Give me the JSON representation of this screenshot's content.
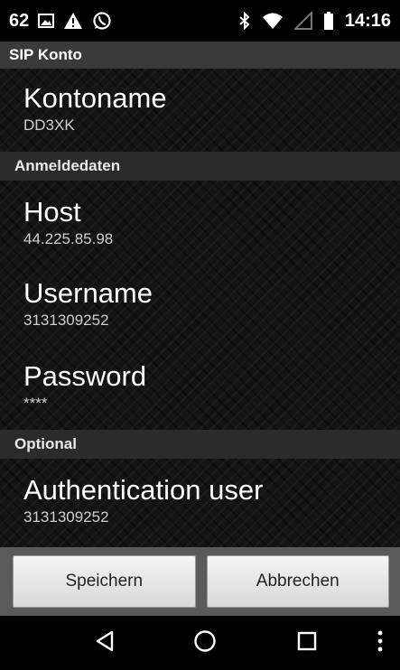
{
  "statusbar": {
    "notification_count": "62",
    "time": "14:16",
    "left_icons": [
      "image-icon",
      "warning-icon",
      "whatsapp-icon"
    ],
    "right_icons": [
      "bluetooth-icon",
      "wifi-icon",
      "signal-icon",
      "battery-icon"
    ]
  },
  "screen": {
    "title": "SIP Konto",
    "account": {
      "title": "Kontoname",
      "value": "DD3XK"
    },
    "sections": {
      "login": {
        "header": "Anmeldedaten",
        "host": {
          "title": "Host",
          "value": "44.225.85.98"
        },
        "username": {
          "title": "Username",
          "value": "3131309252"
        },
        "password": {
          "title": "Password",
          "value": "****"
        }
      },
      "optional": {
        "header": "Optional",
        "auth_user": {
          "title": "Authentication user",
          "value": "3131309252"
        }
      }
    }
  },
  "buttons": {
    "save": "Speichern",
    "cancel": "Abbrechen"
  },
  "navbar": {
    "icons": [
      "back-icon",
      "home-icon",
      "recents-icon",
      "overflow-menu-icon"
    ]
  }
}
